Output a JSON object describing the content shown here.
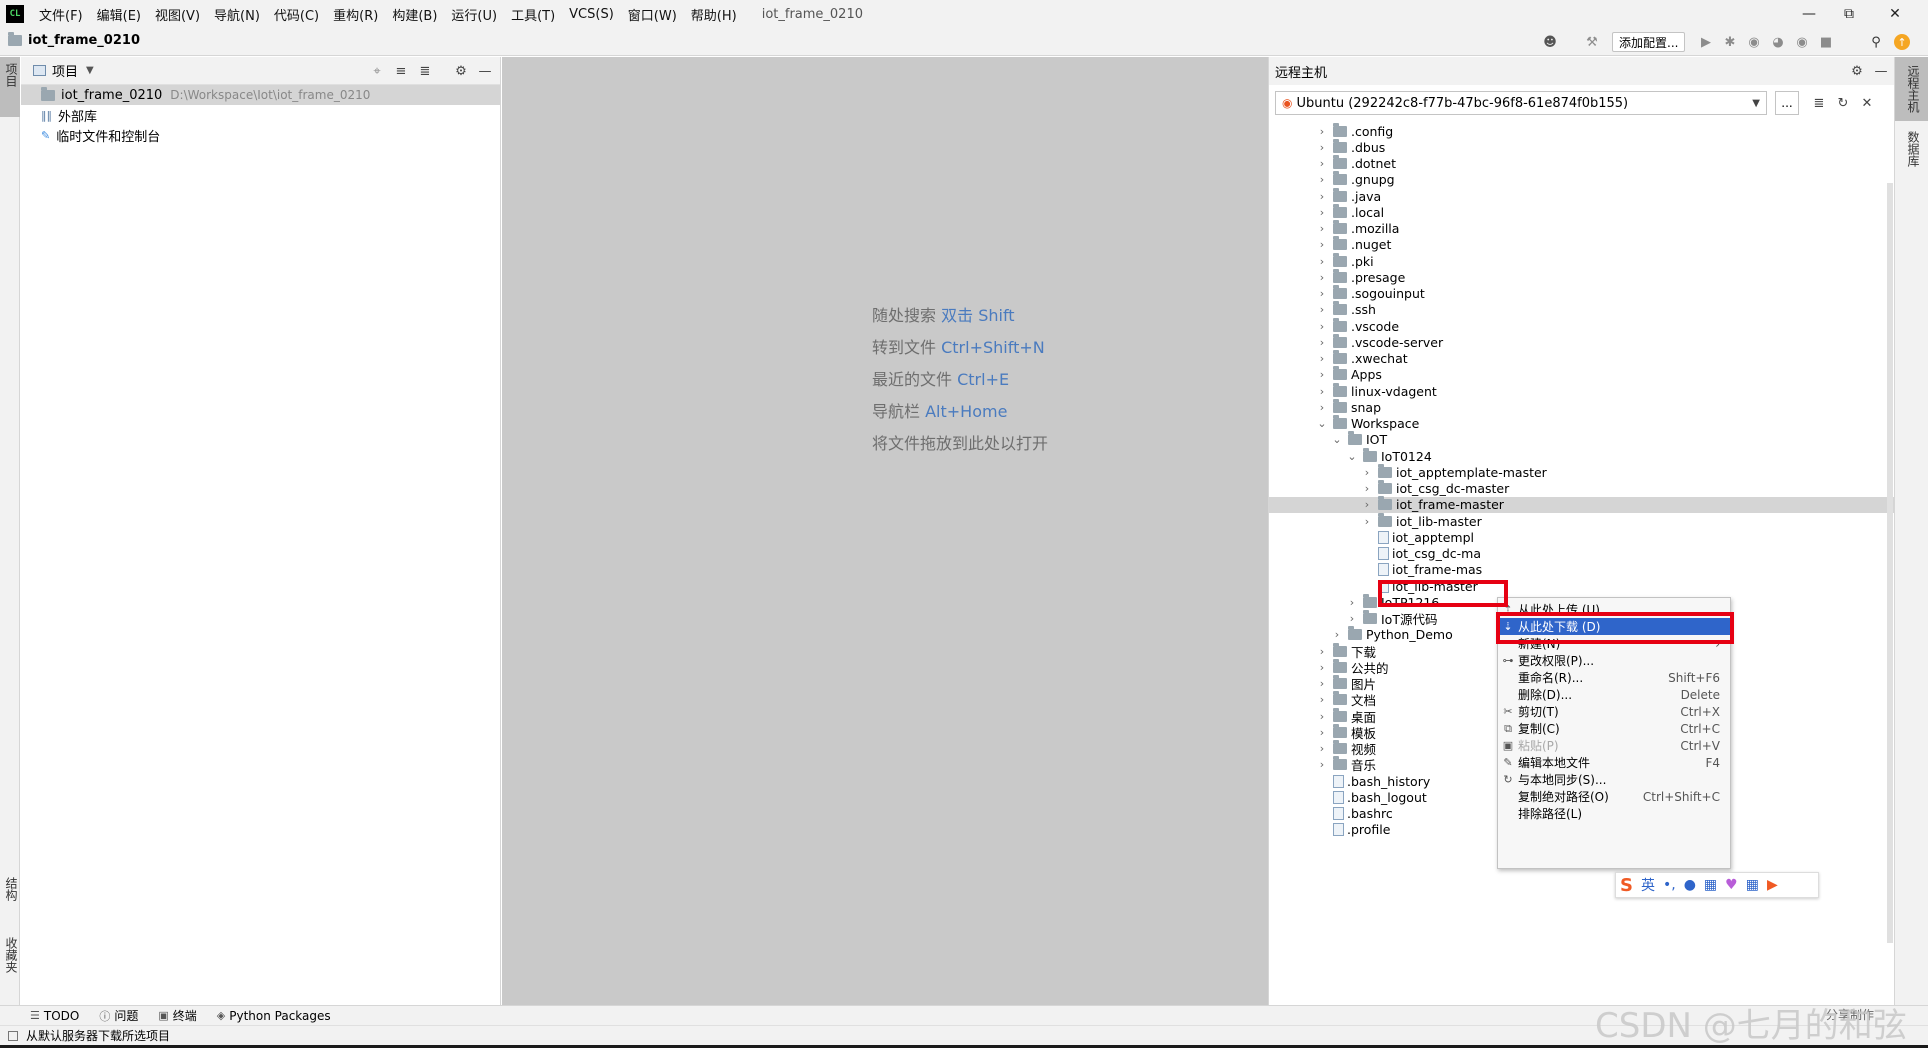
{
  "app": {
    "logo": "CL",
    "window_title": "iot_frame_0210",
    "menu": [
      "文件(F)",
      "编辑(E)",
      "视图(V)",
      "导航(N)",
      "代码(C)",
      "重构(R)",
      "构建(B)",
      "运行(U)",
      "工具(T)",
      "VCS(S)",
      "窗口(W)",
      "帮助(H)"
    ],
    "window_controls": [
      "minimize-icon",
      "restore-icon",
      "close-icon"
    ]
  },
  "toolbar": {
    "project_name": "iot_frame_0210",
    "add_config_label": "添加配置..."
  },
  "left_stripe": {
    "top_tab": "项目",
    "bottom_tabs": [
      "结构",
      "收藏夹"
    ]
  },
  "right_stripe": {
    "tabs": [
      "远程主机",
      "数据库"
    ]
  },
  "project_panel": {
    "header_label": "项目",
    "items": [
      {
        "name": "iot_frame_0210",
        "path": "D:\\Workspace\\Iot\\iot_frame_0210",
        "icon": "folder-icon"
      },
      {
        "name": "外部库",
        "path": "",
        "icon": "library-icon"
      },
      {
        "name": "临时文件和控制台",
        "path": "",
        "icon": "scratch-icon"
      }
    ]
  },
  "editor": {
    "hints": [
      {
        "text": "随处搜索",
        "key": "双击 Shift"
      },
      {
        "text": "转到文件",
        "key": "Ctrl+Shift+N"
      },
      {
        "text": "最近的文件",
        "key": "Ctrl+E"
      },
      {
        "text": "导航栏",
        "key": "Alt+Home"
      },
      {
        "text": "将文件拖放到此处以打开",
        "key": ""
      }
    ]
  },
  "remote_panel": {
    "title": "远程主机",
    "host": "Ubuntu (292242c8-f77b-47bc-96f8-61e874f0b155)",
    "browse_label": "...",
    "tree": [
      {
        "label": ".config",
        "depth": 0,
        "type": "folder",
        "state": "collapsed"
      },
      {
        "label": ".dbus",
        "depth": 0,
        "type": "folder",
        "state": "collapsed"
      },
      {
        "label": ".dotnet",
        "depth": 0,
        "type": "folder",
        "state": "collapsed"
      },
      {
        "label": ".gnupg",
        "depth": 0,
        "type": "folder",
        "state": "collapsed"
      },
      {
        "label": ".java",
        "depth": 0,
        "type": "folder",
        "state": "collapsed"
      },
      {
        "label": ".local",
        "depth": 0,
        "type": "folder",
        "state": "collapsed"
      },
      {
        "label": ".mozilla",
        "depth": 0,
        "type": "folder",
        "state": "collapsed"
      },
      {
        "label": ".nuget",
        "depth": 0,
        "type": "folder",
        "state": "collapsed"
      },
      {
        "label": ".pki",
        "depth": 0,
        "type": "folder",
        "state": "collapsed"
      },
      {
        "label": ".presage",
        "depth": 0,
        "type": "folder",
        "state": "collapsed"
      },
      {
        "label": ".sogouinput",
        "depth": 0,
        "type": "folder",
        "state": "collapsed"
      },
      {
        "label": ".ssh",
        "depth": 0,
        "type": "folder",
        "state": "collapsed"
      },
      {
        "label": ".vscode",
        "depth": 0,
        "type": "folder",
        "state": "collapsed"
      },
      {
        "label": ".vscode-server",
        "depth": 0,
        "type": "folder",
        "state": "collapsed"
      },
      {
        "label": ".xwechat",
        "depth": 0,
        "type": "folder",
        "state": "collapsed"
      },
      {
        "label": "Apps",
        "depth": 0,
        "type": "folder",
        "state": "collapsed"
      },
      {
        "label": "linux-vdagent",
        "depth": 0,
        "type": "folder",
        "state": "collapsed"
      },
      {
        "label": "snap",
        "depth": 0,
        "type": "folder",
        "state": "collapsed"
      },
      {
        "label": "Workspace",
        "depth": 0,
        "type": "folder",
        "state": "expanded"
      },
      {
        "label": "IOT",
        "depth": 1,
        "type": "folder",
        "state": "expanded"
      },
      {
        "label": "IoT0124",
        "depth": 2,
        "type": "folder",
        "state": "expanded"
      },
      {
        "label": "iot_apptemplate-master",
        "depth": 3,
        "type": "folder",
        "state": "collapsed"
      },
      {
        "label": "iot_csg_dc-master",
        "depth": 3,
        "type": "folder",
        "state": "collapsed"
      },
      {
        "label": "iot_frame-master",
        "depth": 3,
        "type": "folder",
        "state": "collapsed",
        "selected": true
      },
      {
        "label": "iot_lib-master",
        "depth": 3,
        "type": "folder",
        "state": "collapsed"
      },
      {
        "label": "iot_apptempl",
        "depth": 3,
        "type": "file",
        "state": "none"
      },
      {
        "label": "iot_csg_dc-ma",
        "depth": 3,
        "type": "file",
        "state": "none"
      },
      {
        "label": "iot_frame-mas",
        "depth": 3,
        "type": "file",
        "state": "none"
      },
      {
        "label": "iot_lib-master",
        "depth": 3,
        "type": "file",
        "state": "none"
      },
      {
        "label": "IoTP1216",
        "depth": 2,
        "type": "folder",
        "state": "collapsed"
      },
      {
        "label": "IoT源代码",
        "depth": 2,
        "type": "folder",
        "state": "collapsed"
      },
      {
        "label": "Python_Demo",
        "depth": 1,
        "type": "folder",
        "state": "collapsed"
      },
      {
        "label": "下载",
        "depth": 0,
        "type": "folder",
        "state": "collapsed"
      },
      {
        "label": "公共的",
        "depth": 0,
        "type": "folder",
        "state": "collapsed"
      },
      {
        "label": "图片",
        "depth": 0,
        "type": "folder",
        "state": "collapsed"
      },
      {
        "label": "文档",
        "depth": 0,
        "type": "folder",
        "state": "collapsed"
      },
      {
        "label": "桌面",
        "depth": 0,
        "type": "folder",
        "state": "collapsed"
      },
      {
        "label": "模板",
        "depth": 0,
        "type": "folder",
        "state": "collapsed"
      },
      {
        "label": "视频",
        "depth": 0,
        "type": "folder",
        "state": "collapsed"
      },
      {
        "label": "音乐",
        "depth": 0,
        "type": "folder",
        "state": "collapsed"
      },
      {
        "label": ".bash_history",
        "depth": 0,
        "type": "file",
        "state": "none"
      },
      {
        "label": ".bash_logout",
        "depth": 0,
        "type": "file",
        "state": "none"
      },
      {
        "label": ".bashrc",
        "depth": 0,
        "type": "file",
        "state": "none"
      },
      {
        "label": ".profile",
        "depth": 0,
        "type": "file",
        "state": "none"
      }
    ]
  },
  "context_menu": {
    "items": [
      {
        "icon": "upload-icon",
        "label": "从此处上传 (U)",
        "shortcut": "",
        "state": "normal"
      },
      {
        "icon": "download-icon",
        "label": "从此处下载 (D)",
        "shortcut": "",
        "state": "selected"
      },
      {
        "icon": "",
        "label": "新建(N)",
        "shortcut": "›",
        "state": "normal"
      },
      {
        "icon": "key-icon",
        "label": "更改权限(P)...",
        "shortcut": "",
        "state": "normal"
      },
      {
        "icon": "",
        "label": "重命名(R)...",
        "shortcut": "Shift+F6",
        "state": "normal"
      },
      {
        "icon": "",
        "label": "删除(D)...",
        "shortcut": "Delete",
        "state": "normal"
      },
      {
        "icon": "scissors-icon",
        "label": "剪切(T)",
        "shortcut": "Ctrl+X",
        "state": "normal"
      },
      {
        "icon": "copy-icon",
        "label": "复制(C)",
        "shortcut": "Ctrl+C",
        "state": "normal"
      },
      {
        "icon": "paste-icon",
        "label": "粘贴(P)",
        "shortcut": "Ctrl+V",
        "state": "disabled"
      },
      {
        "icon": "pencil-icon",
        "label": "编辑本地文件",
        "shortcut": "F4",
        "state": "normal"
      },
      {
        "icon": "sync-icon",
        "label": "与本地同步(S)...",
        "shortcut": "",
        "state": "normal"
      },
      {
        "icon": "",
        "label": "复制绝对路径(O)",
        "shortcut": "Ctrl+Shift+C",
        "state": "normal"
      },
      {
        "icon": "",
        "label": "排除路径(L)",
        "shortcut": "",
        "state": "normal"
      }
    ]
  },
  "ime": {
    "logo": "S",
    "lang": "英"
  },
  "bottom_tools": [
    "TODO",
    "问题",
    "终端",
    "Python Packages"
  ],
  "status": {
    "message": "从默认服务器下载所选项目",
    "right_text": "分享制作"
  },
  "watermark": "CSDN @七月的和弦",
  "colors": {
    "accent": "#2f65ca",
    "highlight_box": "#e60012",
    "editor_bg": "#c9c9c9",
    "hint_key": "#4a7bbf"
  }
}
